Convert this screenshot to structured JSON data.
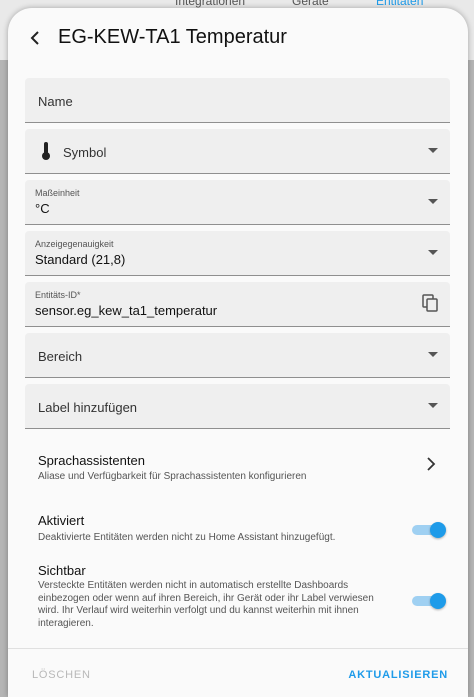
{
  "background": {
    "nav_items": [
      "Integrationen",
      "Geräte",
      "Entitäten"
    ]
  },
  "dialog": {
    "title": "EG-KEW-TA1 Temperatur"
  },
  "fields": {
    "name_label": "Name",
    "symbol_label": "Symbol",
    "unit_label": "Maßeinheit",
    "unit_value": "°C",
    "precision_label": "Anzeigegenauigkeit",
    "precision_value": "Standard (21,8)",
    "entity_id_label": "Entitäts-ID*",
    "entity_id_value": "sensor.eg_kew_ta1_temperatur",
    "area_label": "Bereich",
    "label_add": "Label hinzufügen"
  },
  "voice": {
    "title": "Sprachassistenten",
    "subtitle": "Aliase und Verfügbarkeit für Sprachassistenten konfigurieren"
  },
  "enabled": {
    "title": "Aktiviert",
    "subtitle": "Deaktivierte Entitäten werden nicht zu Home Assistant hinzugefügt.",
    "state": true
  },
  "visible": {
    "title": "Sichtbar",
    "subtitle": "Versteckte Entitäten werden nicht in automatisch erstellte Dashboards einbezogen oder wenn auf ihren Bereich, ihr Gerät oder ihr Label verwiesen wird. Ihr Verlauf wird weiterhin verfolgt und du kannst weiterhin mit ihnen interagieren.",
    "state": true
  },
  "footer": {
    "delete_label": "LÖSCHEN",
    "update_label": "AKTUALISIEREN"
  },
  "colors": {
    "accent": "#1e9be9",
    "disabled": "#b8b8b8"
  }
}
